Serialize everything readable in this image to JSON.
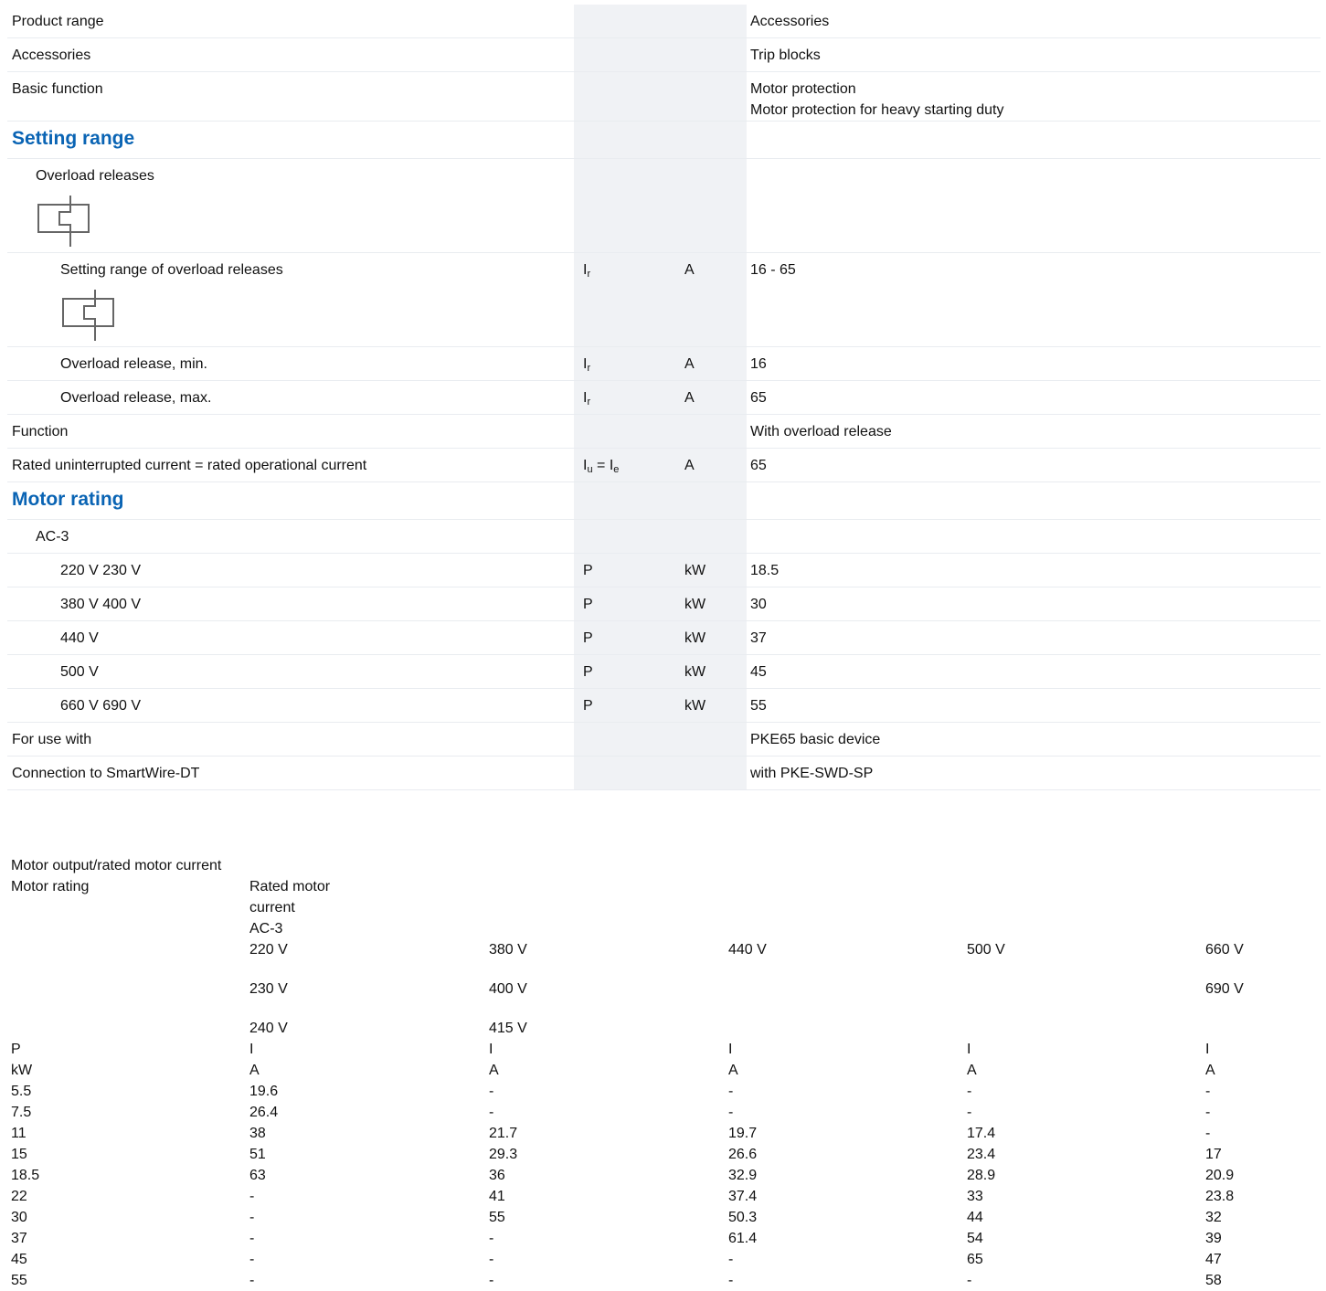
{
  "spec": {
    "product_range": {
      "label": "Product range",
      "value": "Accessories"
    },
    "accessories": {
      "label": "Accessories",
      "value": "Trip blocks"
    },
    "basic_function": {
      "label": "Basic function",
      "value1": "Motor protection",
      "value2": "Motor protection for heavy starting duty"
    },
    "setting_range_heading": "Setting range",
    "overload_releases": {
      "label": "Overload releases"
    },
    "setting_range_overload": {
      "label": "Setting range of overload releases",
      "symbol": "I",
      "sub": "r",
      "unit": "A",
      "value": "16 - 65"
    },
    "overload_min": {
      "label": "Overload release, min.",
      "symbol": "I",
      "sub": "r",
      "unit": "A",
      "value": "16"
    },
    "overload_max": {
      "label": "Overload release, max.",
      "symbol": "I",
      "sub": "r",
      "unit": "A",
      "value": "65"
    },
    "function": {
      "label": "Function",
      "value": "With overload release"
    },
    "rated_current": {
      "label": "Rated uninterrupted current = rated operational current",
      "sym1": "I",
      "sub1": "u",
      "eq": " = ",
      "sym2": "I",
      "sub2": "e",
      "unit": "A",
      "value": "65"
    },
    "motor_rating_heading": "Motor rating",
    "ac3": {
      "label": "AC-3"
    },
    "ratings": [
      {
        "label": "220 V 230 V",
        "symbol": "P",
        "unit": "kW",
        "value": "18.5"
      },
      {
        "label": "380 V 400 V",
        "symbol": "P",
        "unit": "kW",
        "value": "30"
      },
      {
        "label": "440 V",
        "symbol": "P",
        "unit": "kW",
        "value": "37"
      },
      {
        "label": "500 V",
        "symbol": "P",
        "unit": "kW",
        "value": "45"
      },
      {
        "label": "660 V 690 V",
        "symbol": "P",
        "unit": "kW",
        "value": "55"
      }
    ],
    "for_use_with": {
      "label": "For use with",
      "value": "PKE65 basic device"
    },
    "smartwire": {
      "label": "Connection to SmartWire-DT",
      "value": "with PKE-SWD-SP"
    }
  },
  "motor_table": {
    "title": "Motor output/rated motor current",
    "col0_header": "Motor rating",
    "col1_header_lines": [
      "Rated motor",
      "current",
      "AC-3"
    ],
    "voltages_row1": [
      "220 V",
      "380 V",
      "440 V",
      "500 V",
      "660 V"
    ],
    "voltages_row2": [
      "230 V",
      "400 V",
      "",
      "",
      "690 V"
    ],
    "voltages_row3": [
      "240 V",
      "415 V",
      "",
      "",
      ""
    ],
    "symbol_row": [
      "P",
      "I",
      "I",
      "I",
      "I",
      "I"
    ],
    "unit_row": [
      "kW",
      "A",
      "A",
      "A",
      "A",
      "A"
    ],
    "rows": [
      [
        "5.5",
        "19.6",
        "-",
        "-",
        "-",
        "-"
      ],
      [
        "7.5",
        "26.4",
        "-",
        "-",
        "-",
        "-"
      ],
      [
        "11",
        "38",
        "21.7",
        "19.7",
        "17.4",
        "-"
      ],
      [
        "15",
        "51",
        "29.3",
        "26.6",
        "23.4",
        "17"
      ],
      [
        "18.5",
        "63",
        "36",
        "32.9",
        "28.9",
        "20.9"
      ],
      [
        "22",
        "-",
        "41",
        "37.4",
        "33",
        "23.8"
      ],
      [
        "30",
        "-",
        "55",
        "50.3",
        "44",
        "32"
      ],
      [
        "37",
        "-",
        "-",
        "61.4",
        "54",
        "39"
      ],
      [
        "45",
        "-",
        "-",
        "-",
        "65",
        "47"
      ],
      [
        "55",
        "-",
        "-",
        "-",
        "-",
        "58"
      ]
    ]
  }
}
